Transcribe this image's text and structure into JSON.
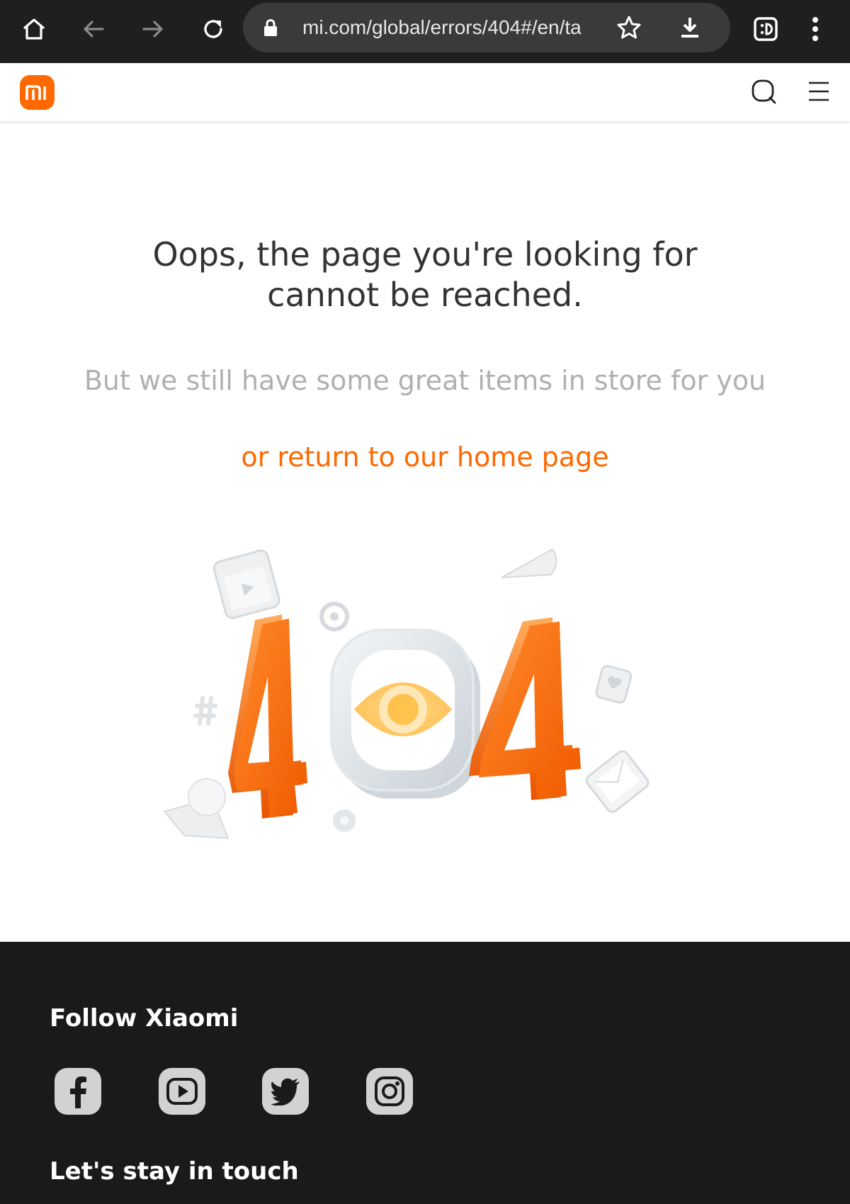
{
  "browser": {
    "url": "mi.com/global/errors/404#/en/ta",
    "icons": [
      "home-icon",
      "back-icon",
      "forward-icon",
      "reload-icon",
      "lock-icon",
      "star-icon",
      "download-icon",
      "extension-icon",
      "more-icon"
    ]
  },
  "header": {
    "logo_text": "mi",
    "icons": [
      "search-icon",
      "menu-icon"
    ]
  },
  "error": {
    "headline_line1": "Oops, the page you're looking for",
    "headline_line2": "cannot be reached.",
    "subline": "But we still have some great items in store for you",
    "home_link": "or return to our home page",
    "graphic_text": "404"
  },
  "footer": {
    "follow_title": "Follow Xiaomi",
    "social": [
      "facebook-icon",
      "youtube-icon",
      "twitter-icon",
      "instagram-icon"
    ],
    "touch_title": "Let's stay in touch"
  },
  "colors": {
    "brand_orange": "#ff6900",
    "chrome_bg": "#1f1f1f",
    "footer_bg": "#1a1a1a",
    "headline": "#333333",
    "subline": "#b0b0b0"
  }
}
